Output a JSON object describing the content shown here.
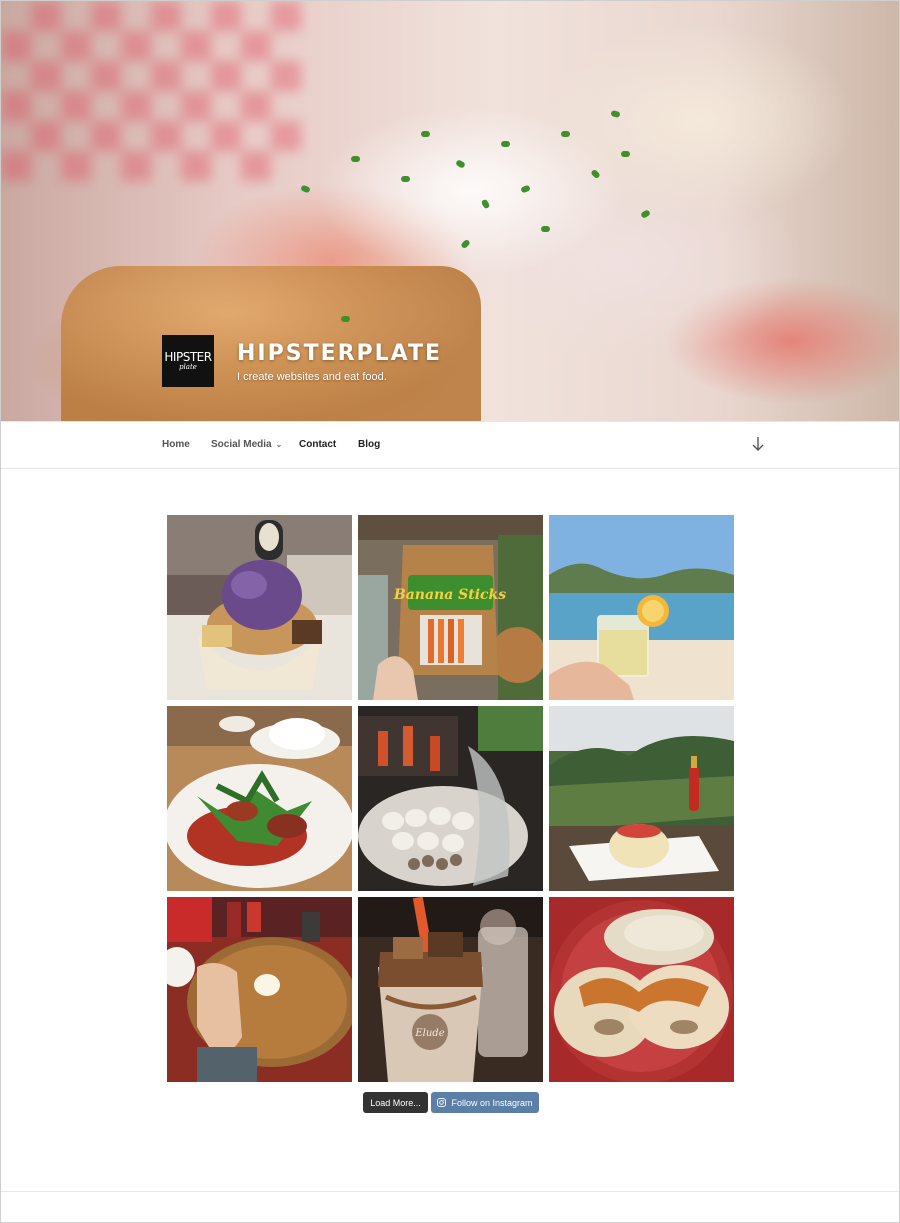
{
  "site": {
    "logo_line1": "HIPSTER",
    "logo_line2": "plate",
    "title": "HIPSTERPLATE",
    "tagline": "I create websites and eat food."
  },
  "nav": {
    "items": [
      {
        "label": "Home"
      },
      {
        "label": "Social Media"
      },
      {
        "label": "Contact"
      },
      {
        "label": "Blog"
      }
    ],
    "scroll_icon": "arrow-down-icon"
  },
  "gallery": {
    "photos": [
      {
        "name": "purple-ube-sundae-photo"
      },
      {
        "name": "banana-sticks-snack-photo",
        "label": "Banana Sticks"
      },
      {
        "name": "beach-drink-photo"
      },
      {
        "name": "salad-plate-photo"
      },
      {
        "name": "eggs-market-photo"
      },
      {
        "name": "mountain-plate-photo"
      },
      {
        "name": "pancake-hand-photo"
      },
      {
        "name": "iced-drink-cup-photo",
        "label": "Elude"
      },
      {
        "name": "pupusa-plate-photo"
      }
    ]
  },
  "buttons": {
    "load_more": "Load More...",
    "follow": "Follow on Instagram",
    "follow_icon": "instagram-icon"
  },
  "colors": {
    "load_more_bg": "#333333",
    "follow_bg": "#5b7fa6"
  }
}
